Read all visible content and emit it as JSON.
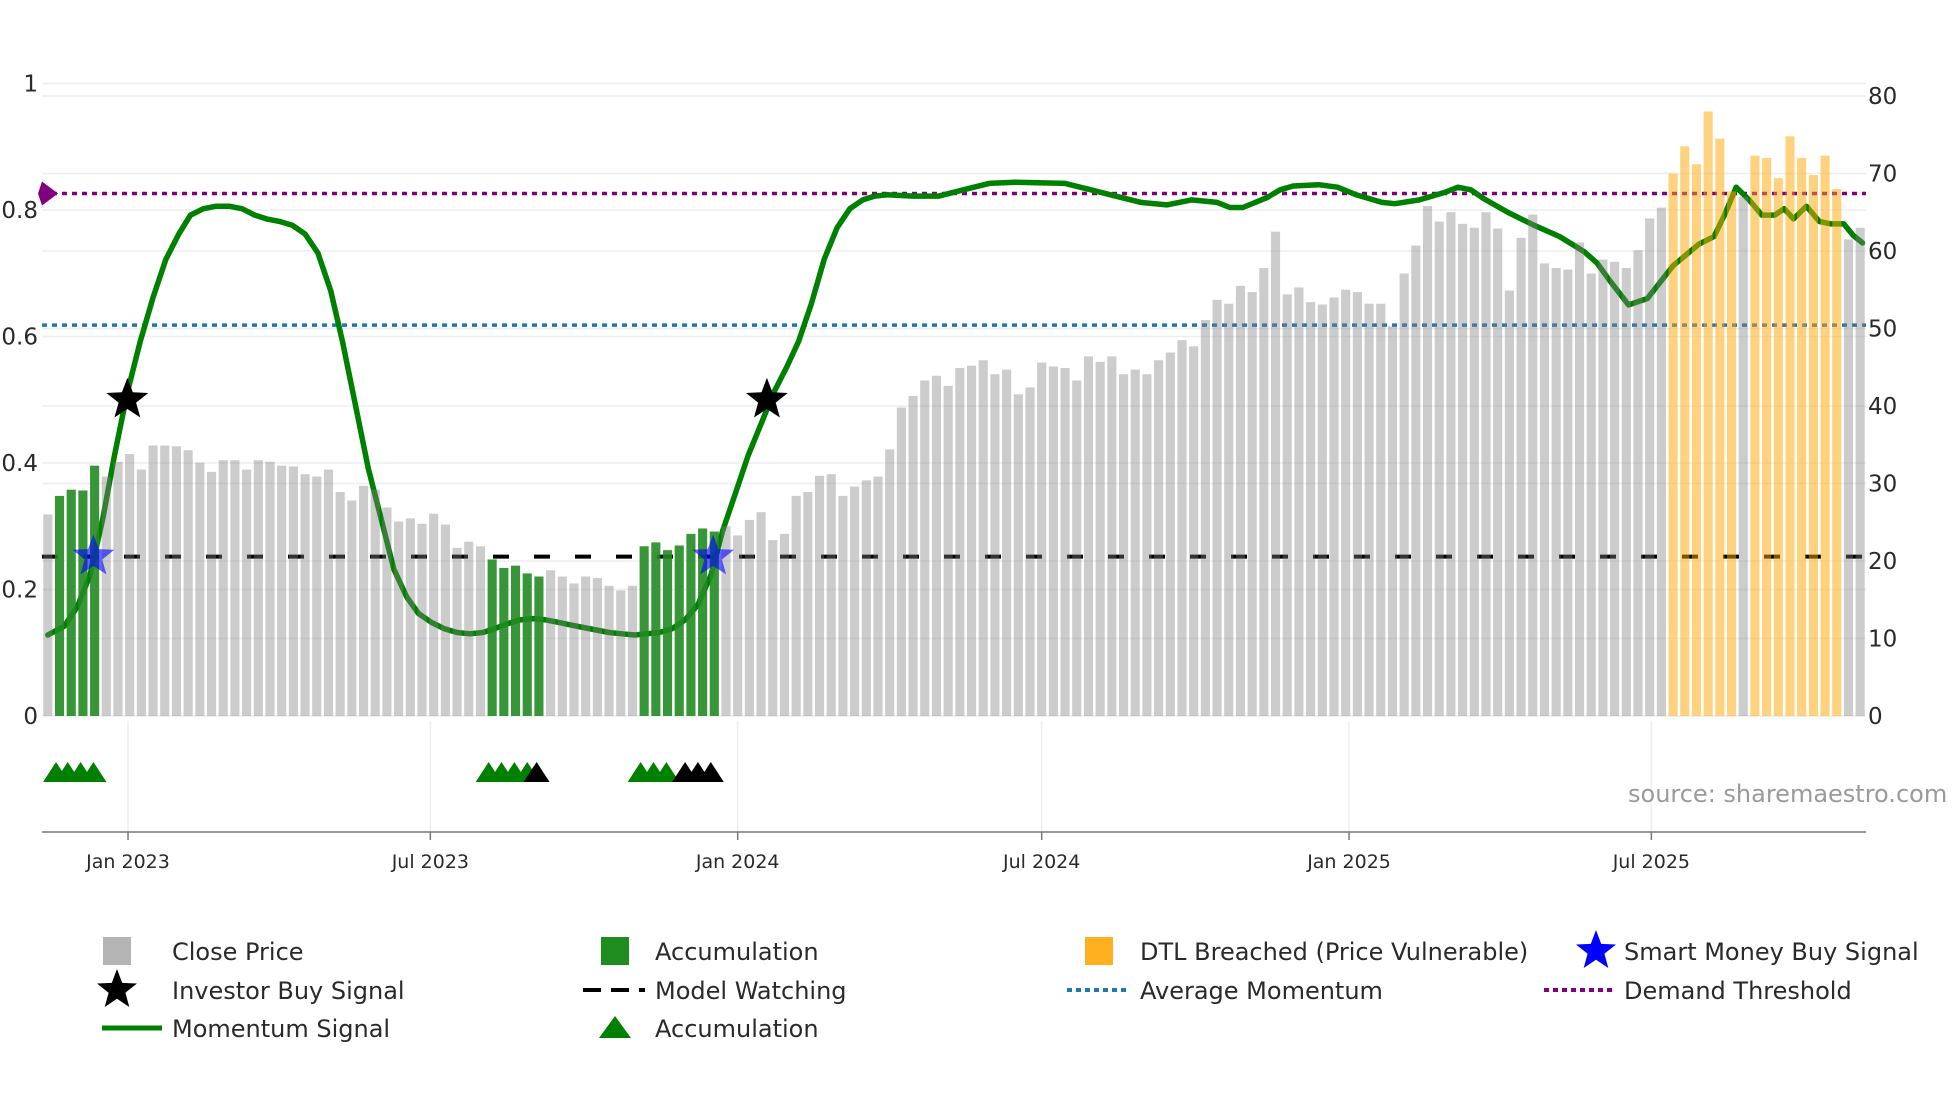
{
  "chart_data": {
    "type": "bar",
    "title": "",
    "source_note": "source: sharemaestro.com",
    "start_week": "2022-11-14",
    "interval_days": 7,
    "left_axis": {
      "range": [
        0,
        1
      ],
      "ticks": [
        "0",
        "0.2",
        "0.4",
        "0.6",
        "0.8",
        "1"
      ],
      "tick_values": [
        0,
        0.2,
        0.4,
        0.6,
        0.8,
        1
      ]
    },
    "right_axis": {
      "range": [
        0,
        80
      ],
      "ticks": [
        "0",
        "10",
        "20",
        "30",
        "40",
        "50",
        "60",
        "70",
        "80"
      ],
      "tick_values": [
        0,
        10,
        20,
        30,
        40,
        50,
        60,
        70,
        80
      ]
    },
    "x_ticks": [
      {
        "label": "Jan 2023",
        "date": "2023-01-01"
      },
      {
        "label": "Jul 2023",
        "date": "2023-07-01"
      },
      {
        "label": "Jan 2024",
        "date": "2024-01-01"
      },
      {
        "label": "Jul 2024",
        "date": "2024-07-01"
      },
      {
        "label": "Jan 2025",
        "date": "2025-01-01"
      },
      {
        "label": "Jul 2025",
        "date": "2025-07-01"
      }
    ],
    "close_price": [
      26,
      28.4,
      29.2,
      29.1,
      32.3,
      30.9,
      32.8,
      33.8,
      31.8,
      34.9,
      34.9,
      34.8,
      34.3,
      32.7,
      31.5,
      33,
      33,
      31.8,
      33,
      32.8,
      32.3,
      32.2,
      31.2,
      30.9,
      31.8,
      28.9,
      27.8,
      29.7,
      29.2,
      26.9,
      25.1,
      25.5,
      24.8,
      26.1,
      24.7,
      21.7,
      22.5,
      21.9,
      20.2,
      19.1,
      19.4,
      18.4,
      18,
      18.8,
      18,
      17.1,
      18,
      17.8,
      16.8,
      16.2,
      16.8,
      21.9,
      22.4,
      21.4,
      22,
      23.5,
      24.2,
      23.8,
      24.5,
      23.3,
      25.3,
      26.3,
      22.7,
      23.5,
      28.4,
      28.9,
      31.0,
      31.2,
      28.4,
      29.6,
      30.4,
      30.9,
      34.4,
      39.8,
      41.3,
      43.3,
      43.9,
      42.6,
      44.9,
      45.2,
      45.9,
      44.1,
      44.7,
      41.5,
      42.4,
      45.6,
      45.1,
      44.9,
      43.3,
      46.4,
      45.7,
      46.4,
      44.1,
      44.7,
      44.1,
      45.9,
      46.9,
      48.5,
      47.7,
      51.1,
      53.7,
      53.2,
      55.5,
      54.7,
      57.8,
      62.5,
      54.4,
      55.3,
      53.4,
      53.1,
      54,
      55,
      54.7,
      53.2,
      53.2,
      50.3,
      57.1,
      60.7,
      65.8,
      63.8,
      65.0,
      63.5,
      63.0,
      65.0,
      62.9,
      54.9,
      61.7,
      64.7,
      58.4,
      57.8,
      57.6,
      61.1,
      57.1,
      58.9,
      58.6,
      57.8,
      60.1,
      64.2,
      65.6,
      70,
      73.5,
      71.2,
      78,
      74.5,
      67.7,
      67,
      72.3,
      72,
      69.4,
      74.8,
      72,
      69.8,
      72.3,
      68,
      61.5,
      63
    ],
    "accumulation_ranges": [
      [
        1,
        4
      ],
      [
        38,
        42
      ],
      [
        51,
        57
      ]
    ],
    "dtl_breached_ranges": [
      [
        139,
        144
      ],
      [
        146,
        153
      ]
    ],
    "momentum_signal": [
      [
        0,
        0.128
      ],
      [
        1.4,
        0.142
      ],
      [
        2.5,
        0.172
      ],
      [
        3.6,
        0.222
      ],
      [
        4.7,
        0.312
      ],
      [
        5.7,
        0.412
      ],
      [
        6.8,
        0.512
      ],
      [
        7.9,
        0.592
      ],
      [
        9,
        0.662
      ],
      [
        10.1,
        0.722
      ],
      [
        11.2,
        0.762
      ],
      [
        12.2,
        0.792
      ],
      [
        13.3,
        0.802
      ],
      [
        14.4,
        0.806
      ],
      [
        15.5,
        0.806
      ],
      [
        16.6,
        0.802
      ],
      [
        17.7,
        0.792
      ],
      [
        18.7,
        0.786
      ],
      [
        19.8,
        0.782
      ],
      [
        20.9,
        0.776
      ],
      [
        22,
        0.762
      ],
      [
        23.1,
        0.732
      ],
      [
        24.2,
        0.672
      ],
      [
        25.2,
        0.592
      ],
      [
        26.3,
        0.492
      ],
      [
        27.4,
        0.392
      ],
      [
        28.5,
        0.312
      ],
      [
        29.6,
        0.232
      ],
      [
        30.7,
        0.188
      ],
      [
        31.7,
        0.162
      ],
      [
        32.8,
        0.148
      ],
      [
        33.9,
        0.138
      ],
      [
        35,
        0.132
      ],
      [
        36.1,
        0.13
      ],
      [
        37.2,
        0.132
      ],
      [
        38.2,
        0.138
      ],
      [
        39.3,
        0.146
      ],
      [
        40.4,
        0.152
      ],
      [
        41.5,
        0.154
      ],
      [
        42.6,
        0.152
      ],
      [
        43.7,
        0.148
      ],
      [
        44.7,
        0.144
      ],
      [
        45.8,
        0.14
      ],
      [
        46.9,
        0.136
      ],
      [
        48,
        0.132
      ],
      [
        49.1,
        0.13
      ],
      [
        50.2,
        0.128
      ],
      [
        51.2,
        0.13
      ],
      [
        52.3,
        0.132
      ],
      [
        53.4,
        0.138
      ],
      [
        54.5,
        0.152
      ],
      [
        55.6,
        0.176
      ],
      [
        56.7,
        0.222
      ],
      [
        57.7,
        0.292
      ],
      [
        58.8,
        0.352
      ],
      [
        59.9,
        0.412
      ],
      [
        61,
        0.462
      ],
      [
        62.1,
        0.512
      ],
      [
        63.2,
        0.552
      ],
      [
        64.2,
        0.592
      ],
      [
        65.3,
        0.652
      ],
      [
        66.4,
        0.722
      ],
      [
        67.5,
        0.772
      ],
      [
        68.6,
        0.802
      ],
      [
        69.7,
        0.816
      ],
      [
        70.7,
        0.822
      ],
      [
        71.8,
        0.824
      ],
      [
        74,
        0.822
      ],
      [
        76.2,
        0.822
      ],
      [
        78.3,
        0.832
      ],
      [
        80.5,
        0.842
      ],
      [
        82.7,
        0.844
      ],
      [
        87,
        0.842
      ],
      [
        89.2,
        0.832
      ],
      [
        91.3,
        0.822
      ],
      [
        93.5,
        0.812
      ],
      [
        95.7,
        0.808
      ],
      [
        97.8,
        0.816
      ],
      [
        100,
        0.812
      ],
      [
        101.1,
        0.804
      ],
      [
        102.2,
        0.804
      ],
      [
        104.3,
        0.82
      ],
      [
        105.4,
        0.832
      ],
      [
        106.5,
        0.838
      ],
      [
        108.7,
        0.84
      ],
      [
        110.3,
        0.836
      ],
      [
        111.9,
        0.824
      ],
      [
        114.1,
        0.812
      ],
      [
        115.2,
        0.81
      ],
      [
        117.3,
        0.816
      ],
      [
        119.5,
        0.828
      ],
      [
        120.6,
        0.836
      ],
      [
        121.7,
        0.832
      ],
      [
        122.8,
        0.818
      ],
      [
        124.9,
        0.796
      ],
      [
        127.1,
        0.776
      ],
      [
        129.3,
        0.758
      ],
      [
        131.4,
        0.734
      ],
      [
        132.5,
        0.716
      ],
      [
        133.6,
        0.688
      ],
      [
        135.2,
        0.65
      ],
      [
        136.8,
        0.66
      ],
      [
        139,
        0.712
      ],
      [
        141.2,
        0.746
      ],
      [
        142.5,
        0.758
      ],
      [
        143.4,
        0.792
      ],
      [
        144.4,
        0.836
      ],
      [
        145.5,
        0.816
      ],
      [
        146.6,
        0.792
      ],
      [
        147.7,
        0.792
      ],
      [
        148.5,
        0.802
      ],
      [
        149.3,
        0.786
      ],
      [
        150.4,
        0.806
      ],
      [
        151.5,
        0.782
      ],
      [
        152.5,
        0.778
      ],
      [
        153.6,
        0.778
      ],
      [
        154.4,
        0.76
      ],
      [
        155.2,
        0.748
      ]
    ],
    "model_watching": 0.252,
    "average_momentum": 0.618,
    "demand_threshold": 0.826,
    "investor_buy_signals": [
      [
        6.8,
        0.5
      ],
      [
        61.5,
        0.5
      ]
    ],
    "smart_money_buy_signals": [
      [
        3.9,
        0.252
      ],
      [
        56.9,
        0.252
      ]
    ],
    "accumulation_markers": {
      "green": [
        0.7,
        1.7,
        2.8,
        3.9,
        37.7,
        38.8,
        39.9,
        41,
        50.7,
        51.8,
        52.9
      ],
      "black": [
        41.8,
        54.5,
        55.6,
        56.7
      ]
    },
    "colors": {
      "close": "#808080",
      "accumulation": "#228b22",
      "dtl": "#ffa500",
      "momentum": "#008000",
      "avg": "#1f77b4",
      "threshold": "#800080",
      "smart": "#0000ff",
      "investor": "#000000"
    },
    "legend": [
      {
        "label": "Close Price",
        "kind": "square",
        "color": "#b4b4b4"
      },
      {
        "label": "Accumulation",
        "kind": "square",
        "color": "#1e8c1e"
      },
      {
        "label": "DTL Breached (Price Vulnerable)",
        "kind": "square",
        "color": "#ffb020"
      },
      {
        "label": "Smart Money Buy Signal",
        "kind": "star",
        "color": "#0000ff"
      },
      {
        "label": "Investor Buy Signal",
        "kind": "star",
        "color": "#000000"
      },
      {
        "label": "Model Watching",
        "kind": "dash",
        "color": "#000000"
      },
      {
        "label": "Average Momentum",
        "kind": "dot",
        "color": "#1f77b4"
      },
      {
        "label": "Demand Threshold",
        "kind": "dot",
        "color": "#800080"
      },
      {
        "label": "Momentum Signal",
        "kind": "line",
        "color": "#008000"
      },
      {
        "label": "Accumulation",
        "kind": "triangle",
        "color": "#008000"
      }
    ]
  }
}
